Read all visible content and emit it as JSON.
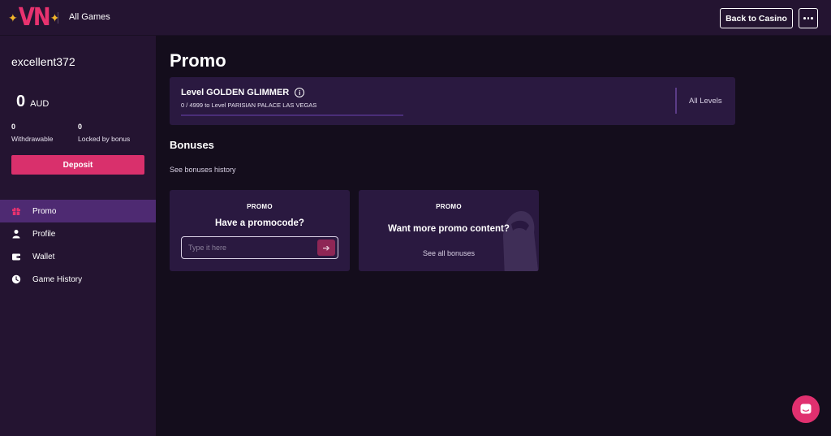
{
  "header": {
    "logo_text": "VN",
    "all_games": "All Games",
    "back_to_casino": "Back to Casino"
  },
  "sidebar": {
    "username": "excellent372",
    "balance": "0",
    "currency": "AUD",
    "withdrawable_value": "0",
    "withdrawable_label": "Withdrawable",
    "locked_value": "0",
    "locked_label": "Locked by bonus",
    "deposit": "Deposit",
    "nav": [
      {
        "label": "Promo",
        "icon": "gift-icon",
        "active": true
      },
      {
        "label": "Profile",
        "icon": "person-icon",
        "active": false
      },
      {
        "label": "Wallet",
        "icon": "wallet-icon",
        "active": false
      },
      {
        "label": "Game History",
        "icon": "clock-icon",
        "active": false
      }
    ]
  },
  "main": {
    "title": "Promo",
    "level": {
      "title": "Level GOLDEN GLIMMER",
      "progress_text": "0 / 4999 to Level PARISIAN PALACE LAS VEGAS",
      "progress_fraction": 0.0,
      "all_levels": "All Levels"
    },
    "bonuses_title": "Bonuses",
    "bonuses_history": "See bonuses history",
    "cards": {
      "promocode": {
        "tag": "PROMO",
        "heading": "Have a promocode?",
        "placeholder": "Type it here"
      },
      "more": {
        "tag": "PROMO",
        "heading": "Want more promo content?",
        "link": "See all bonuses"
      }
    }
  },
  "colors": {
    "accent": "#d9306c",
    "sidebar_bg": "#241431",
    "page_bg": "#140d1c",
    "card_bg": "#2a1940",
    "active_nav": "#4e2a72"
  }
}
